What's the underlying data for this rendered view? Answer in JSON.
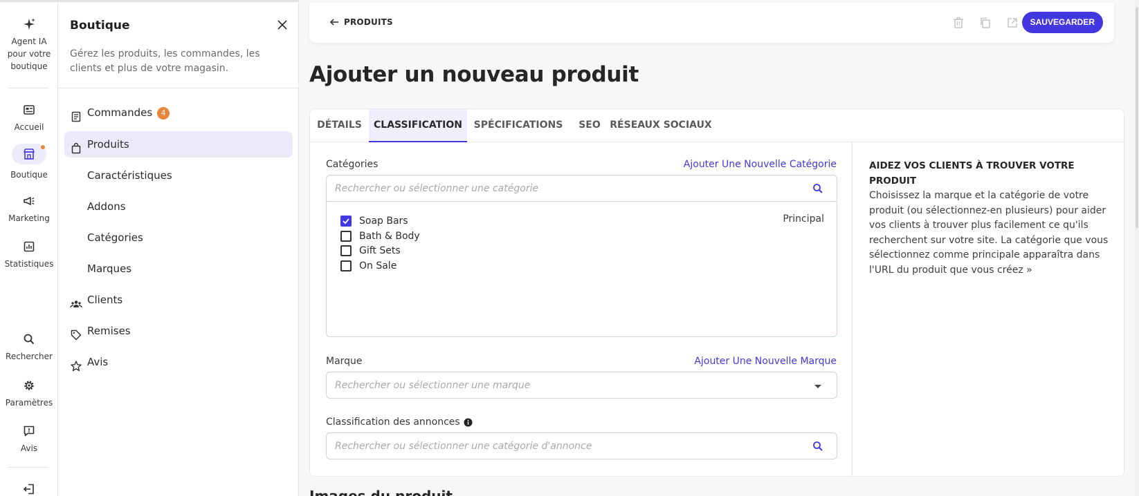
{
  "rail": {
    "ai_label": "Agent IA pour votre boutique",
    "items": [
      {
        "label": "Accueil",
        "icon": "home-dashboard-icon"
      },
      {
        "label": "Boutique",
        "icon": "store-icon"
      },
      {
        "label": "Marketing",
        "icon": "megaphone-icon"
      },
      {
        "label": "Statistiques",
        "icon": "chart-icon"
      },
      {
        "label": "Rechercher",
        "icon": "search-icon"
      },
      {
        "label": "Paramètres",
        "icon": "gear-icon"
      },
      {
        "label": "Avis",
        "icon": "feedback-icon"
      }
    ]
  },
  "sidebar": {
    "title": "Boutique",
    "description": "Gérez les produits, les commandes, les clients et plus de votre magasin.",
    "items": [
      {
        "label": "Commandes",
        "badge": "4"
      },
      {
        "label": "Produits"
      },
      {
        "label": "Caractéristiques"
      },
      {
        "label": "Addons"
      },
      {
        "label": "Catégories"
      },
      {
        "label": "Marques"
      },
      {
        "label": "Clients"
      },
      {
        "label": "Remises"
      },
      {
        "label": "Avis"
      }
    ]
  },
  "topbar": {
    "back_label": "PRODUITS",
    "save_label": "SAUVEGARDER"
  },
  "page": {
    "title": "Ajouter un nouveau produit",
    "next_section_title": "Images du produit"
  },
  "tabs": [
    "DÉTAILS",
    "CLASSIFICATION",
    "SPÉCIFICATIONS",
    "SEO",
    "RÉSEAUX SOCIAUX"
  ],
  "form": {
    "categories_label": "Catégories",
    "add_category_link": "Ajouter Une Nouvelle Catégorie",
    "category_placeholder": "Rechercher ou sélectionner une catégorie",
    "categories": [
      {
        "name": "Soap Bars",
        "checked": true
      },
      {
        "name": "Bath & Body",
        "checked": false
      },
      {
        "name": "Gift Sets",
        "checked": false
      },
      {
        "name": "On Sale",
        "checked": false
      }
    ],
    "principal_label": "Principal",
    "brand_label": "Marque",
    "add_brand_link": "Ajouter Une Nouvelle Marque",
    "brand_placeholder": "Rechercher ou sélectionner une marque",
    "listing_label": "Classification des annonces",
    "listing_placeholder": "Rechercher ou sélectionner une catégorie d'annonce"
  },
  "help": {
    "title": "AIDEZ VOS CLIENTS À TROUVER VOTRE PRODUIT",
    "body": "Choisissez la marque et la catégorie de votre produit (ou sélectionnez-en plusieurs) pour aider vos clients à trouver plus facilement ce qu'ils recherchent sur votre site. La catégorie que vous sélectionnez comme principale apparaîtra dans l'URL du produit que vous créez »"
  },
  "colors": {
    "accent": "#4338e0",
    "badge": "#e8873a",
    "active_bg": "#ebeafb"
  }
}
